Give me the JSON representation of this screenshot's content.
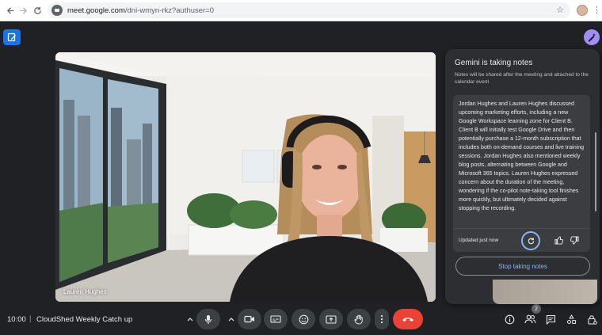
{
  "browser": {
    "url_host": "meet.google.com",
    "url_path": "/dni-wmyn-rkz?authuser=0"
  },
  "video": {
    "participant_name": "Lauren Hughes"
  },
  "gemini": {
    "title": "Gemini is taking notes",
    "subtitle": "Notes will be shared after the meeting and attached to the calendar event",
    "notes": "Jordan Hughes and Lauren Hughes discussed upcoming marketing efforts, including a new Google Workspace learning zone for Client B. Client B will initially test Google Drive and then potentially purchase a 12-month subscription that includes both on-demand courses and live training sessions. Jordan Hughes also mentioned weekly blog posts, alternating between Google and Microsoft 365 topics. Lauren Hughes expressed concern about the duration of the meeting, wondering if the co-pilot note-taking tool finishes more quickly, but ultimately decided against stopping the recording.",
    "updated": "Updated just now",
    "stop_label": "Stop taking notes"
  },
  "bottom_bar": {
    "time": "10:00",
    "separator": "|",
    "meeting_title": "CloudShed Weekly Catch up",
    "people_count": "2"
  },
  "colors": {
    "accent": "#8ab4f8",
    "end_call": "#ea4335",
    "notes_button": "#1a73e8",
    "gemini_button": "#a28cf7"
  }
}
